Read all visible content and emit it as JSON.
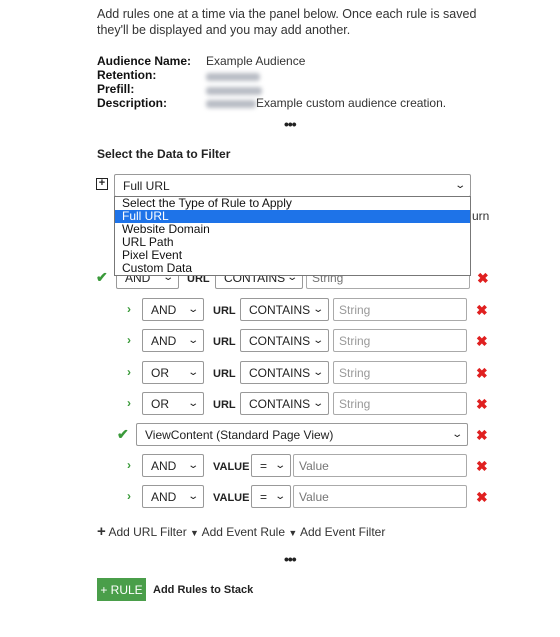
{
  "intro": "Add rules one at a time via the panel below. Once each rule is saved they'll be displayed and you may add another.",
  "audience": {
    "name_label": "Audience Name:",
    "name_value": "Example Audience",
    "retention_label": "Retention:",
    "prefill_label": "Prefill:",
    "description_label": "Description:",
    "description_value": "Example custom audience creation."
  },
  "separator": "•••",
  "section_title": "Select the Data to Filter",
  "rule_type": {
    "selected": "Full URL",
    "options": [
      "Select the Type of Rule to Apply",
      "Full URL",
      "Website Domain",
      "URL Path",
      "Pixel Event",
      "Custom Data"
    ],
    "highlighted_index": 1
  },
  "hidden_fragment": "urn",
  "url_rule": {
    "logic": "AND",
    "field": "URL",
    "operator": "CONTAINS",
    "placeholder": "String"
  },
  "url_filters": [
    {
      "logic": "AND",
      "field": "URL",
      "operator": "CONTAINS",
      "placeholder": "String"
    },
    {
      "logic": "AND",
      "field": "URL",
      "operator": "CONTAINS",
      "placeholder": "String"
    },
    {
      "logic": "OR",
      "field": "URL",
      "operator": "CONTAINS",
      "placeholder": "String"
    },
    {
      "logic": "OR",
      "field": "URL",
      "operator": "CONTAINS",
      "placeholder": "String"
    }
  ],
  "event_rule": {
    "selected": "ViewContent (Standard Page View)"
  },
  "event_filters": [
    {
      "logic": "AND",
      "field": "VALUE",
      "operator": "=",
      "placeholder": "Value"
    },
    {
      "logic": "AND",
      "field": "VALUE",
      "operator": "=",
      "placeholder": "Value"
    }
  ],
  "actions": {
    "add_url_filter": "Add URL Filter",
    "add_event_rule": "Add Event Rule",
    "add_event_filter": "Add Event Filter"
  },
  "rule_button": "+ RULE",
  "rule_button_label": "Add Rules to Stack",
  "colors": {
    "accent_green": "#4a9e4a",
    "remove_red": "#e02020",
    "highlight_blue": "#1e73e8"
  }
}
